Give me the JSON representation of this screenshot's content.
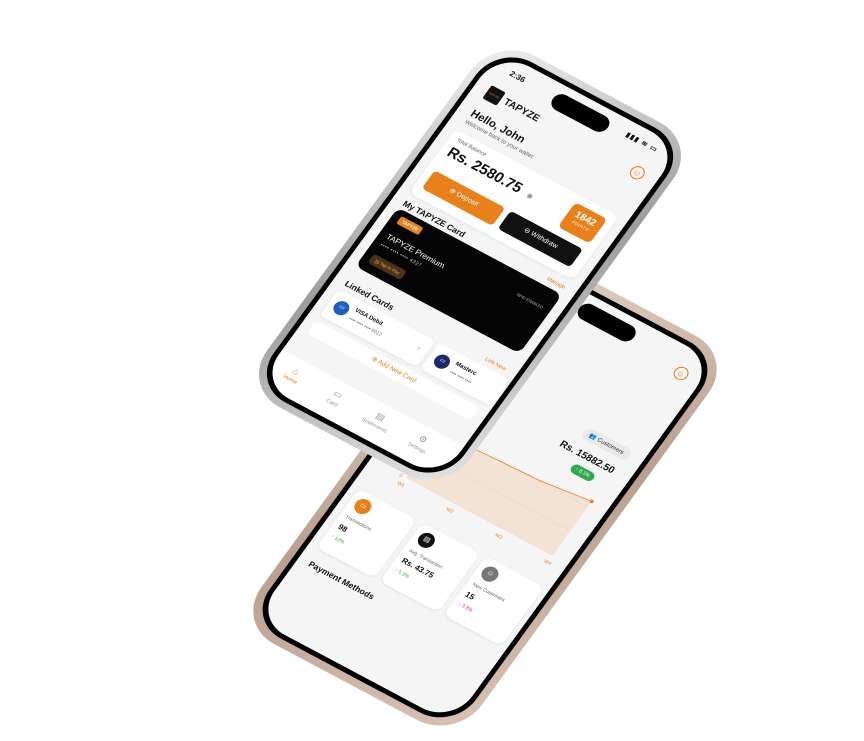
{
  "front": {
    "status_time": "2:36",
    "status_icons": "▮▮▮ ≋ ▭",
    "brand": "TAPYZE",
    "greeting": "Hello, John",
    "greeting_sub": "Welcome back to your wallet",
    "balance_label": "Total Balance",
    "balance": "Rs. 2580.75",
    "points_value": "1842",
    "points_label": "POINTS",
    "deposit_label": "Deposit",
    "withdraw_label": "Withdraw",
    "card_section_title": "My TAPYZE Card",
    "manage_label": "Manage",
    "card_tag": "TAPYZE",
    "rfid": "RFID ENABLED",
    "card_name": "TAPYZE Premium",
    "card_number": "•••• •••• •••• 4327",
    "tap_label": "Tap to Pay",
    "linked_title": "Linked Cards",
    "link_new": "Link New",
    "linked_cards": [
      {
        "name": "VISA Debit",
        "number": "•••• •••• •••• 8912",
        "color": "#1f5fbf"
      },
      {
        "name": "Masterc",
        "number": "•••• •••• ••••",
        "color": "#1b2a6b"
      }
    ],
    "add_card": "Add New Card",
    "nav": [
      {
        "label": "Home",
        "icon": "⌂",
        "active": true
      },
      {
        "label": "Card",
        "icon": "▭",
        "active": false
      },
      {
        "label": "Statements",
        "icon": "▤",
        "active": false
      },
      {
        "label": "Settings",
        "icon": "⚙",
        "active": false
      }
    ]
  },
  "back": {
    "customers_tab": "Customers",
    "revenue": "Rs. 15882.50",
    "growth": "↑ 8.1%",
    "payment_methods": "Payment Methods",
    "stats": [
      {
        "label": "Transactions",
        "value": "98",
        "change": "↑ 12%",
        "color": "#e8801c",
        "change_color": "#2faa4a"
      },
      {
        "label": "Avg. Transaction",
        "value": "Rs. 43.75",
        "change": "↑ 5.3%",
        "color": "#111111",
        "change_color": "#2faa4a"
      },
      {
        "label": "New Customers",
        "value": "15",
        "change": "↓ 3.8%",
        "color": "#777777",
        "change_color": "#d93a3a"
      }
    ]
  },
  "chart_data": {
    "type": "area",
    "categories": [
      "W1",
      "W2",
      "W3",
      "W4"
    ],
    "y_tick_labels": [
      "0",
      "1500",
      "3000"
    ],
    "series": [
      {
        "values": [
          2800,
          2900,
          3000,
          3300
        ]
      }
    ],
    "color": "#e8801c"
  }
}
